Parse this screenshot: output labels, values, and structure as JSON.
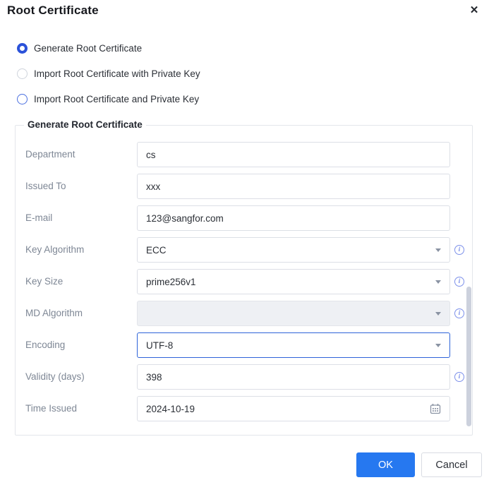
{
  "dialog": {
    "title": "Root Certificate",
    "close_icon": "✕"
  },
  "radio_options": [
    {
      "label": "Generate Root Certificate",
      "selected": true
    },
    {
      "label": "Import Root Certificate with Private Key",
      "selected": false
    },
    {
      "label": "Import Root Certificate and Private Key",
      "selected": false
    }
  ],
  "form": {
    "legend": "Generate Root Certificate",
    "fields": [
      {
        "label": "Department",
        "value": "cs"
      },
      {
        "label": "Issued To",
        "value": "xxx"
      },
      {
        "label": "E-mail",
        "value": "123@sangfor.com"
      },
      {
        "label": "Key Algorithm",
        "value": "ECC"
      },
      {
        "label": "Key Size",
        "value": "prime256v1"
      },
      {
        "label": "MD Algorithm",
        "value": ""
      },
      {
        "label": "Encoding",
        "value": "UTF-8"
      },
      {
        "label": "Validity (days)",
        "value": "398"
      },
      {
        "label": "Time Issued",
        "value": "2024-10-19"
      }
    ],
    "info_icon_glyph": "i"
  },
  "footer": {
    "ok_label": "OK",
    "cancel_label": "Cancel"
  },
  "colors": {
    "primary_button": "#2678f0",
    "radio_selected": "#2b52d9",
    "focused_border": "#2d63d9",
    "info_icon": "#7c90ea",
    "label_gray": "#7e8795"
  }
}
